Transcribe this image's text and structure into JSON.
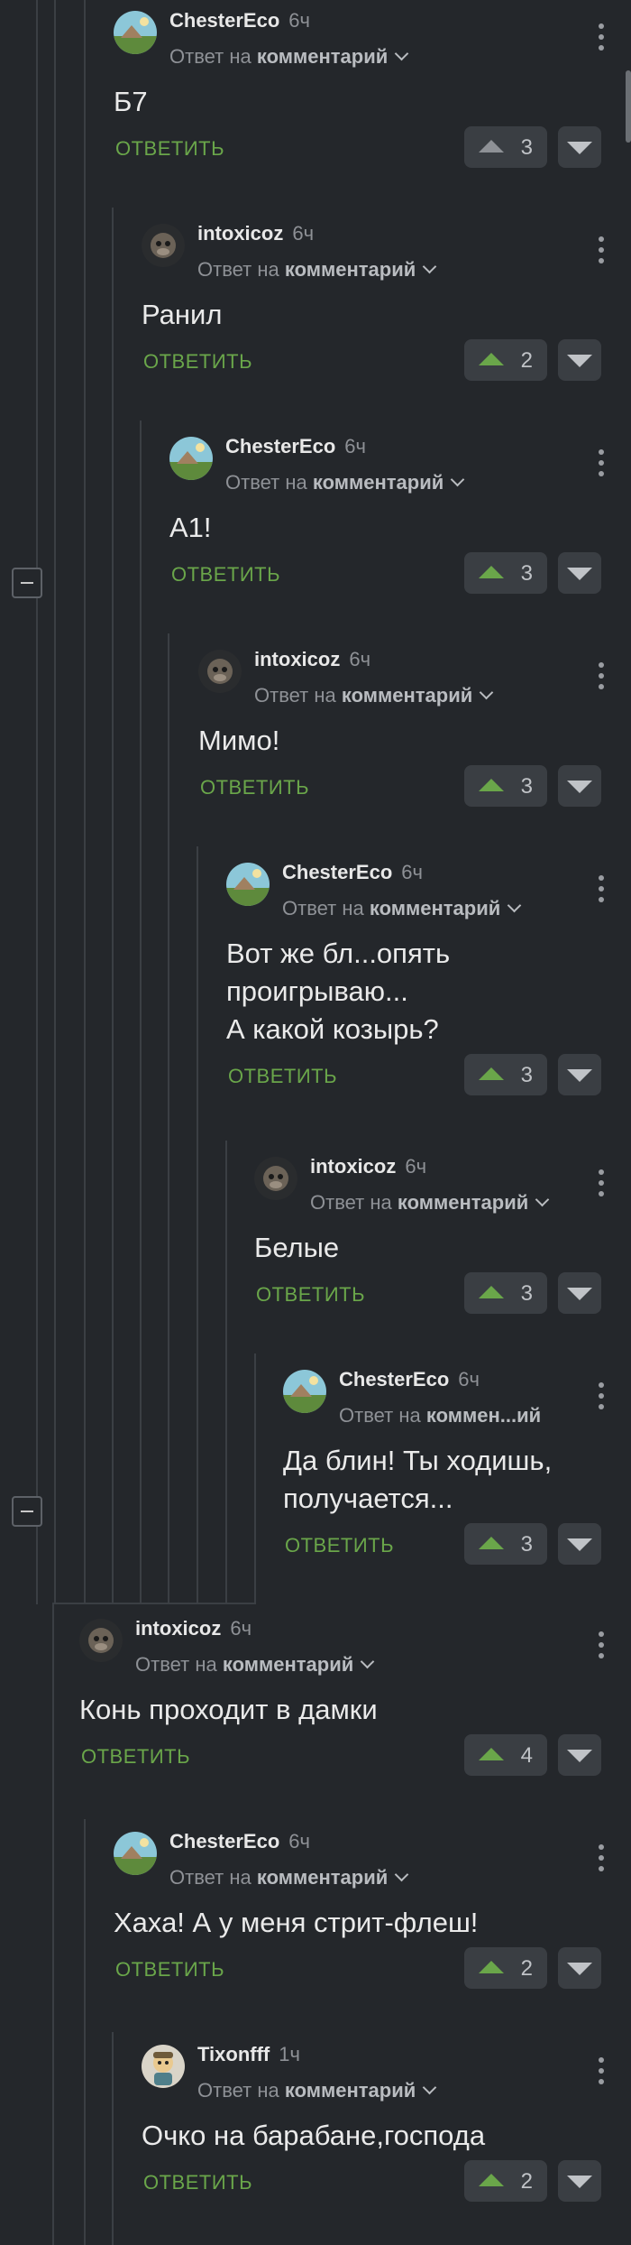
{
  "ui": {
    "reply_prefix": "Ответ на",
    "reply_target": "комментарий",
    "reply_button": "ОТВЕТИТЬ",
    "accent": "#6aa64a",
    "background": "#24272b"
  },
  "comments": [
    {
      "author": "ChesterEco",
      "time": "6ч",
      "reply_prefix": "Ответ на",
      "reply_target": "комментарий",
      "text": "Б7",
      "rating": "3",
      "avatar": "landscape-avatar"
    },
    {
      "author": "intoxicoz",
      "time": "6ч",
      "reply_prefix": "Ответ на",
      "reply_target": "комментарий",
      "text": "Ранил",
      "rating": "2",
      "avatar": "monkey-avatar"
    },
    {
      "author": "ChesterEco",
      "time": "6ч",
      "reply_prefix": "Ответ на",
      "reply_target": "комментарий",
      "text": "А1!",
      "rating": "3",
      "avatar": "landscape-avatar"
    },
    {
      "author": "intoxicoz",
      "time": "6ч",
      "reply_prefix": "Ответ на",
      "reply_target": "комментарий",
      "text": "Мимо!",
      "rating": "3",
      "avatar": "monkey-avatar"
    },
    {
      "author": "ChesterEco",
      "time": "6ч",
      "reply_prefix": "Ответ на",
      "reply_target": "комментарий",
      "text": "Вот же бл...опять проигрываю...\nА какой козырь?",
      "rating": "3",
      "avatar": "landscape-avatar"
    },
    {
      "author": "intoxicoz",
      "time": "6ч",
      "reply_prefix": "Ответ на",
      "reply_target": "комментарий",
      "text": "Белые",
      "rating": "3",
      "avatar": "monkey-avatar"
    },
    {
      "author": "ChesterEco",
      "time": "6ч",
      "reply_prefix": "Ответ на",
      "reply_target": "коммен...ий",
      "text": "Да блин! Ты ходишь, получается...",
      "rating": "3",
      "avatar": "landscape-avatar"
    },
    {
      "author": "intoxicoz",
      "time": "6ч",
      "reply_prefix": "Ответ на",
      "reply_target": "комментарий",
      "text": "Конь проходит в дамки",
      "rating": "4",
      "avatar": "monkey-avatar"
    },
    {
      "author": "ChesterEco",
      "time": "6ч",
      "reply_prefix": "Ответ на",
      "reply_target": "комментарий",
      "text": "Хаха! А у меня стрит-флеш!",
      "rating": "2",
      "avatar": "landscape-avatar"
    },
    {
      "author": "Tixonfff",
      "time": "1ч",
      "reply_prefix": "Ответ на",
      "reply_target": "комментарий",
      "text": "Очко на барабане,господа",
      "rating": "2",
      "avatar": "cartoon-avatar"
    }
  ]
}
